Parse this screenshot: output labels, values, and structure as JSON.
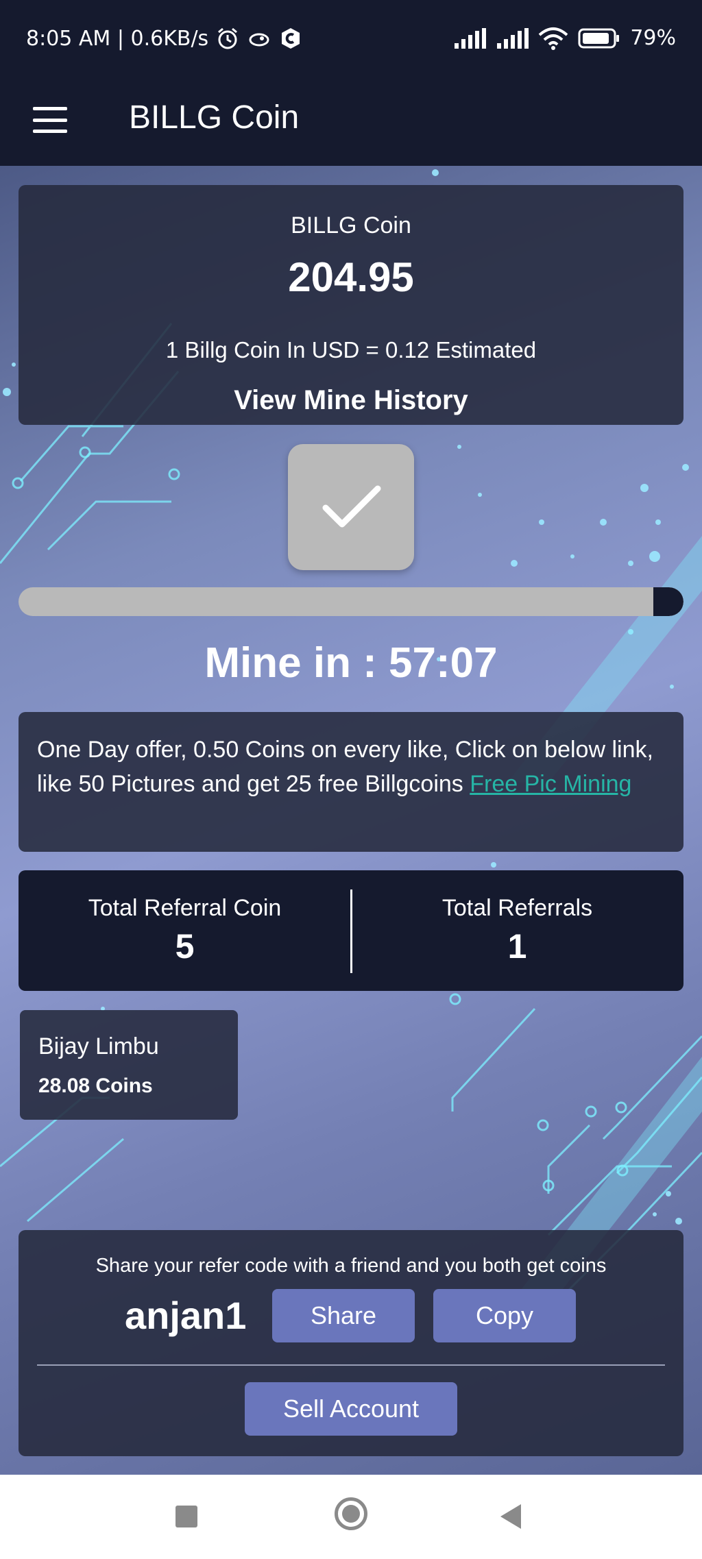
{
  "status_bar": {
    "time_speed": "8:05 AM | 0.6KB/s",
    "battery": "79%",
    "icons": [
      "alarm-icon",
      "notification-icon",
      "app-icon",
      "signal-icon",
      "signal-icon",
      "wifi-icon",
      "battery-icon"
    ]
  },
  "app_bar": {
    "title": "BILLG Coin",
    "menu_icon": "hamburger-icon"
  },
  "balance": {
    "label": "BILLG Coin",
    "value": "204.95",
    "rate": "1 Billg Coin In USD = 0.12 Estimated",
    "history_link": "View Mine History"
  },
  "mine": {
    "button_icon": "checkmark-icon",
    "progress_fraction": 0.045,
    "timer": "Mine in : 57:07"
  },
  "offer": {
    "text": "One Day offer, 0.50 Coins on every like, Click on below link, like 50 Pictures and get 25 free Billgcoins ",
    "link_text": "Free Pic Mining "
  },
  "referral_stats": {
    "coin_label": "Total Referral Coin",
    "coin_value": "5",
    "count_label": "Total Referrals",
    "count_value": "1"
  },
  "referrals": [
    {
      "name": "Bijay Limbu",
      "coins": "28.08 Coins"
    }
  ],
  "share": {
    "text": "Share your refer code with a friend and you both get coins",
    "code": "anjan1",
    "share_label": "Share",
    "copy_label": "Copy",
    "sell_label": "Sell Account"
  },
  "colors": {
    "dark": "#151a2e",
    "accent_button": "#6a76bc",
    "link": "#26b5a6"
  }
}
